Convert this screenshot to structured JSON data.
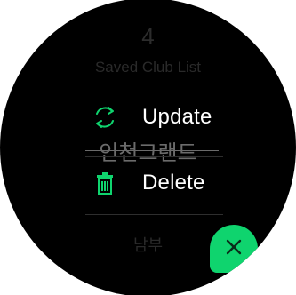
{
  "background_list": {
    "count": "4",
    "title": "Saved Club List",
    "items": [
      "인천그랜드",
      "남부"
    ]
  },
  "menu": {
    "update_label": "Update",
    "delete_label": "Delete"
  },
  "colors": {
    "accent": "#0fd46e",
    "background": "#000000",
    "text": "#ffffff"
  },
  "icons": {
    "update": "refresh-icon",
    "delete": "trash-icon",
    "close": "close-icon"
  }
}
